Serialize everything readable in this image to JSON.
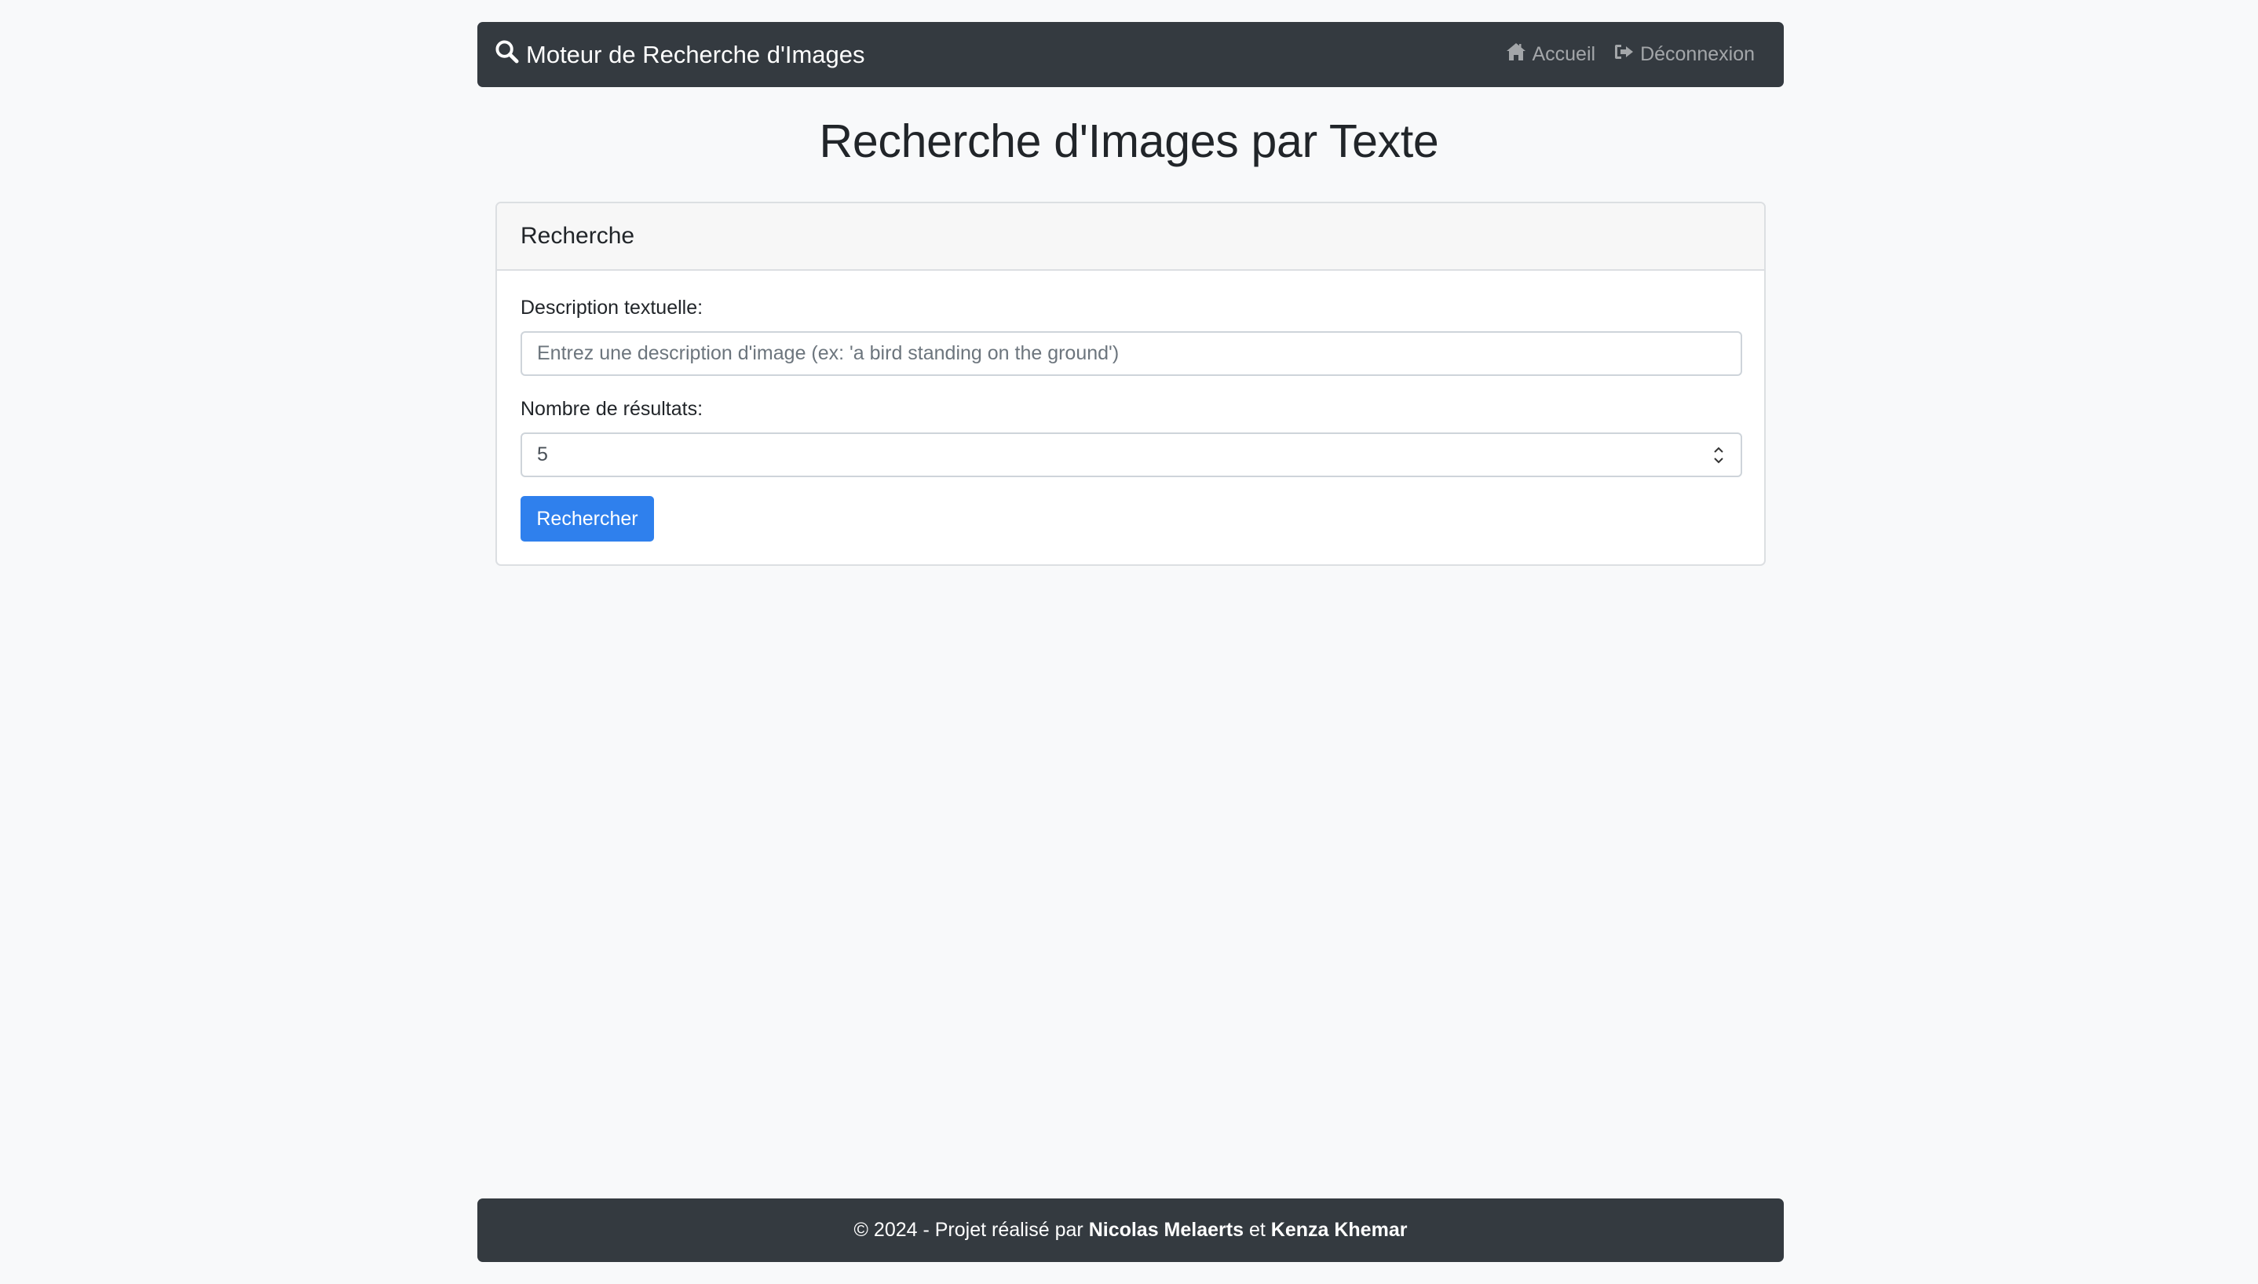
{
  "navbar": {
    "brand_icon": "search-icon",
    "brand": "Moteur de Recherche d'Images",
    "links": [
      {
        "icon": "home-icon",
        "label": "Accueil"
      },
      {
        "icon": "sign-out-icon",
        "label": "Déconnexion"
      }
    ]
  },
  "main": {
    "title": "Recherche d'Images par Texte"
  },
  "search_card": {
    "header": "Recherche",
    "description_label": "Description textuelle:",
    "description_placeholder": "Entrez une description d'image (ex: 'a bird standing on the ground')",
    "description_value": "",
    "count_label": "Nombre de résultats:",
    "count_value": "5",
    "submit_label": "Rechercher"
  },
  "footer": {
    "prefix": "© 2024 - Projet réalisé par",
    "author1": "Nicolas Melaerts",
    "conjunction": "et",
    "author2": "Kenza Khemar"
  },
  "colors": {
    "navbar_bg": "#343a40",
    "page_bg": "#f8f9fa",
    "primary": "#2f80ed"
  }
}
